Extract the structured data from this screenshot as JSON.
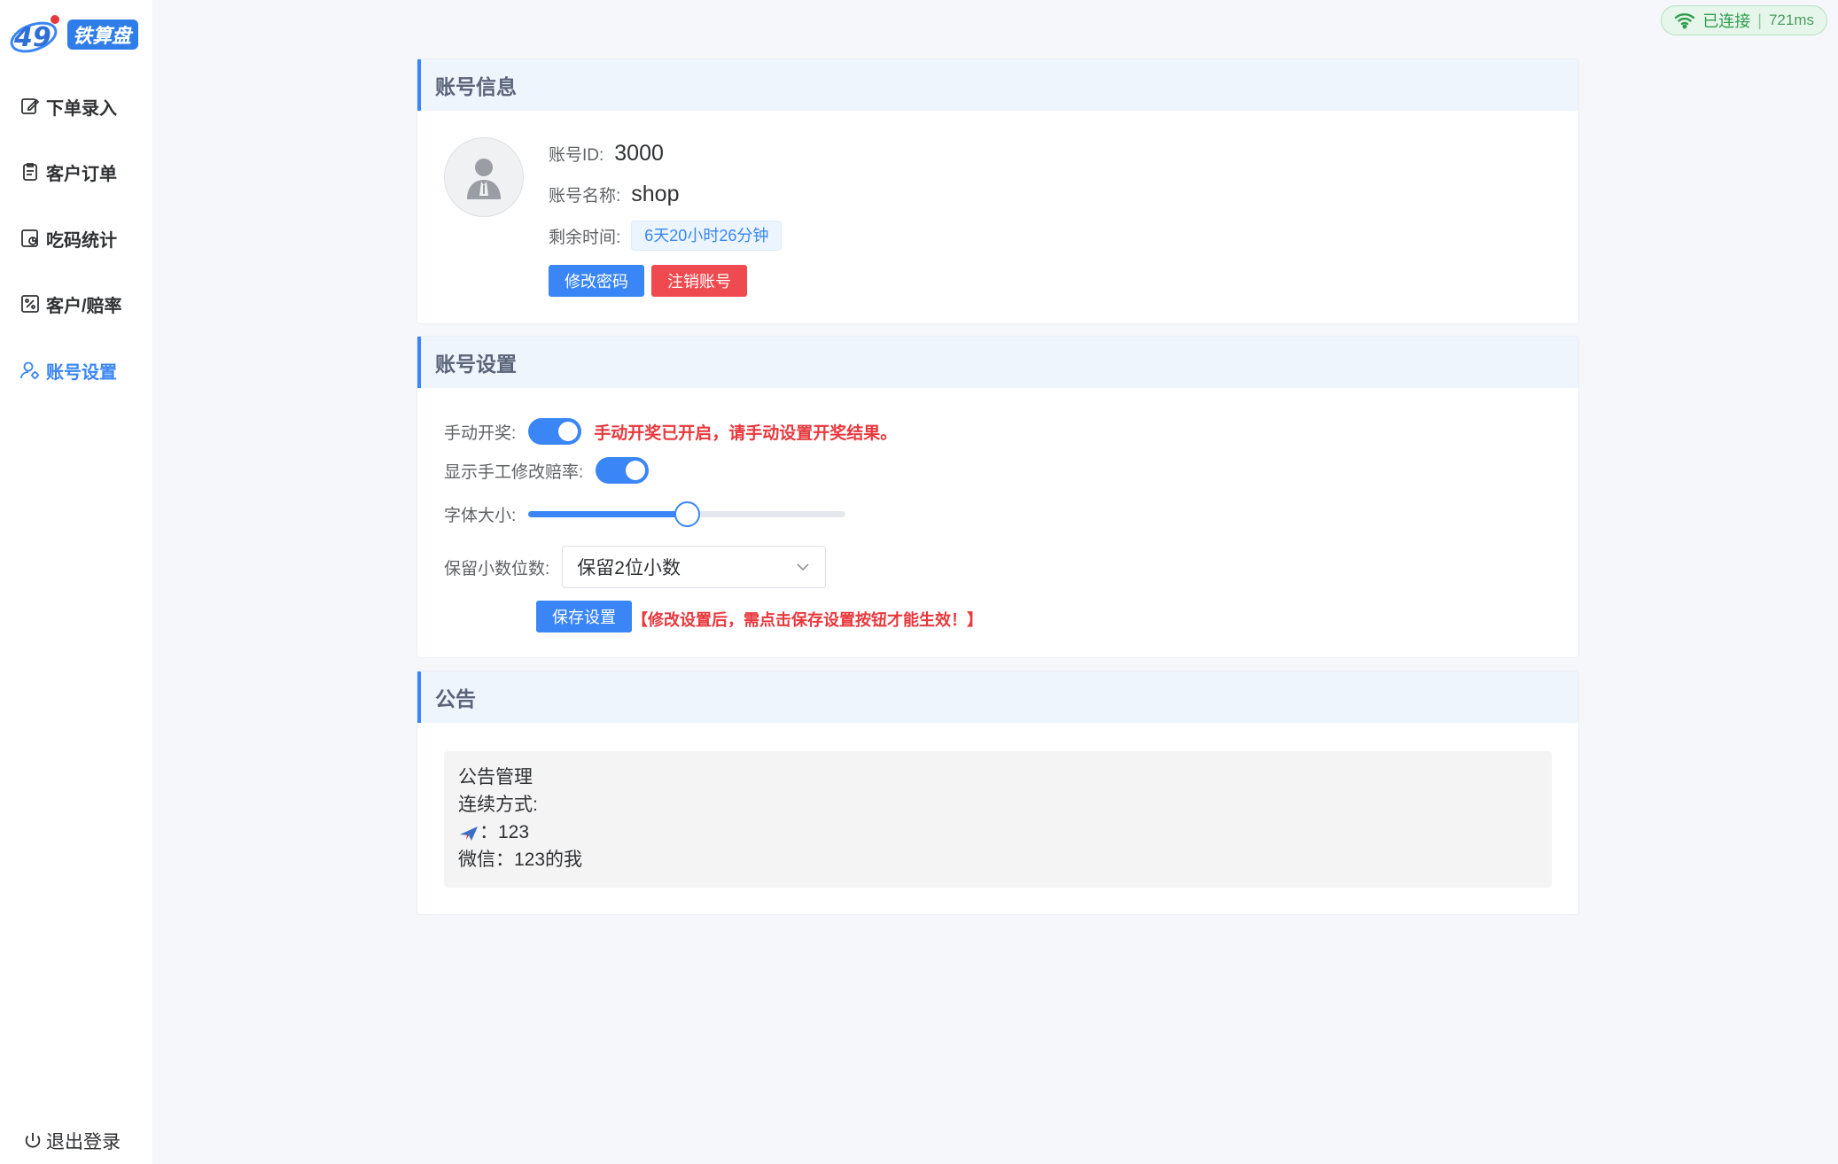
{
  "brand": {
    "name": "铁算盘",
    "badge": "49"
  },
  "connection": {
    "status": "已连接",
    "latency": "721ms"
  },
  "nav": [
    {
      "label": "下单录入",
      "icon": "edit-icon"
    },
    {
      "label": "客户订单",
      "icon": "clipboard-icon"
    },
    {
      "label": "吃码统计",
      "icon": "chart-doc-icon"
    },
    {
      "label": "客户/赔率",
      "icon": "percent-icon"
    },
    {
      "label": "账号设置",
      "icon": "user-settings-icon",
      "active": true
    }
  ],
  "logout_label": "退出登录",
  "account_info": {
    "title": "账号信息",
    "id_label": "账号ID:",
    "id_value": "3000",
    "name_label": "账号名称:",
    "name_value": "shop",
    "time_label": "剩余时间:",
    "time_value": "6天20小时26分钟",
    "change_password": "修改密码",
    "cancel_account": "注销账号"
  },
  "account_settings": {
    "title": "账号设置",
    "manual_draw_label": "手动开奖:",
    "manual_draw_on": true,
    "manual_draw_warning": "手动开奖已开启，请手动设置开奖结果。",
    "show_odds_label": "显示手工修改赔率:",
    "show_odds_on": true,
    "font_size_label": "字体大小:",
    "font_size_fraction": 0.5,
    "decimals_label": "保留小数位数:",
    "decimals_value": "保留2位小数",
    "save_button": "保存设置",
    "save_hint": "【修改设置后，需点击保存设置按钮才能生效！】"
  },
  "announcement": {
    "title": "公告",
    "line1": "公告管理",
    "line2": "连续方式:",
    "line3_value": "：123",
    "line4": "微信：123的我"
  },
  "colors": {
    "primary": "#3a86f7",
    "danger": "#ee4a4f",
    "success": "#2f9e4f"
  }
}
